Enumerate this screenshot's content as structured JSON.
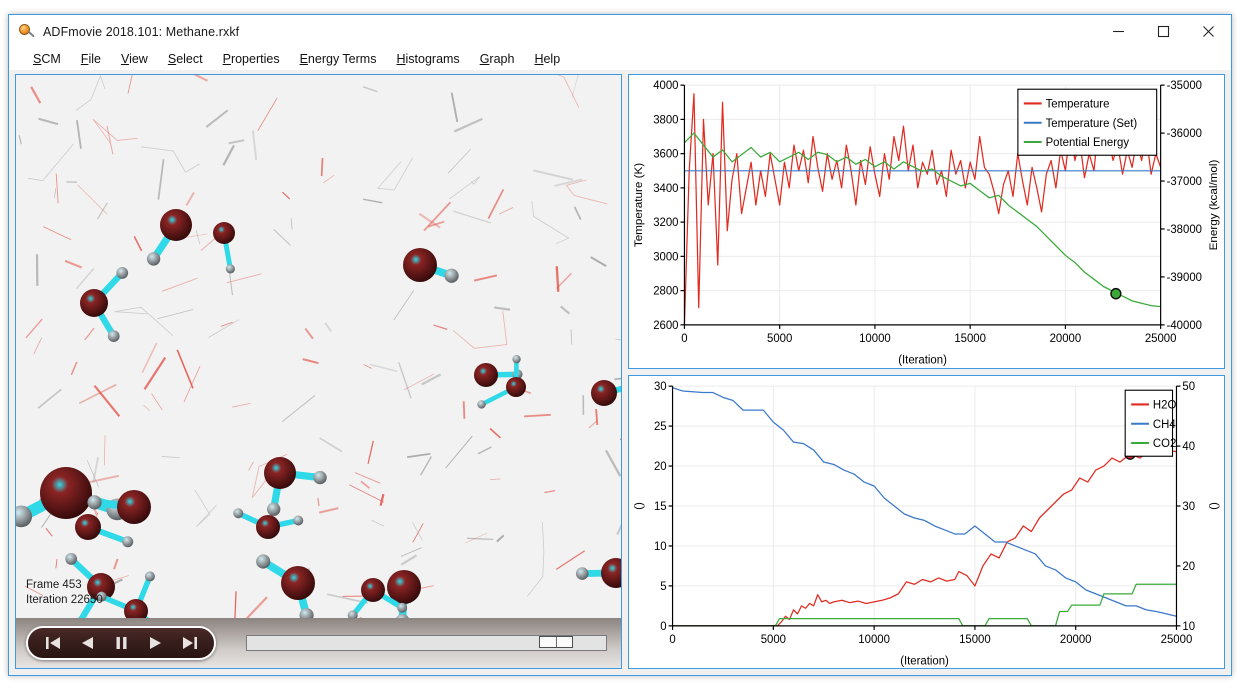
{
  "window": {
    "title": "ADFmovie 2018.101: Methane.rxkf",
    "icon": "magnifier-icon",
    "minimize_label": "–",
    "maximize_label": "□",
    "close_label": "✕"
  },
  "menubar": {
    "items": [
      {
        "label": "SCM",
        "mnemonic": "S"
      },
      {
        "label": "File",
        "mnemonic": "F"
      },
      {
        "label": "View",
        "mnemonic": "V"
      },
      {
        "label": "Select",
        "mnemonic": "S"
      },
      {
        "label": "Properties",
        "mnemonic": "P"
      },
      {
        "label": "Energy Terms",
        "mnemonic": "E"
      },
      {
        "label": "Histograms",
        "mnemonic": "H"
      },
      {
        "label": "Graph",
        "mnemonic": "G"
      },
      {
        "label": "Help",
        "mnemonic": "H"
      }
    ]
  },
  "viewport": {
    "frame_label": "Frame 453",
    "iteration_label": "Iteration 22650",
    "background_color": "#f2f2f2",
    "atom_colors": {
      "oxygen": "#5c1414",
      "hydrogen": "#8f9396",
      "bond": "#2fd9e8"
    }
  },
  "transport": {
    "buttons": [
      {
        "name": "skip-to-start-button",
        "icon": "skip-start-icon"
      },
      {
        "name": "step-back-button",
        "icon": "rewind-icon"
      },
      {
        "name": "pause-button",
        "icon": "pause-icon"
      },
      {
        "name": "play-button",
        "icon": "play-icon"
      },
      {
        "name": "skip-to-end-button",
        "icon": "skip-end-icon"
      }
    ]
  },
  "frame_slider": {
    "min": 0,
    "max": 100,
    "value": 90,
    "name": "frame-slider"
  },
  "chart_data": [
    {
      "type": "line",
      "id": "energy-chart",
      "title": "",
      "xlabel": "(Iteration)",
      "ylabel": "Temperature (K)",
      "ylabel_right": "Energy (kcal/mol)",
      "xlim": [
        0,
        25000
      ],
      "xticks": [
        0,
        5000,
        10000,
        15000,
        20000,
        25000
      ],
      "ylim": [
        2600,
        4000
      ],
      "yticks": [
        2600,
        2800,
        3000,
        3200,
        3400,
        3600,
        3800,
        4000
      ],
      "ylim_right": [
        -40000,
        -35000
      ],
      "yticks_right": [
        -40000,
        -39000,
        -38000,
        -37000,
        -36000,
        -35000
      ],
      "grid": true,
      "legend_position": "top-right",
      "marker": {
        "x": 22650,
        "y": -39350,
        "axis": "right",
        "color": "#3aa93a"
      },
      "series": [
        {
          "name": "Temperature",
          "color": "#e02b20",
          "axis": "left",
          "x": [
            0,
            250,
            500,
            750,
            1000,
            1250,
            1500,
            1750,
            2000,
            2250,
            2500,
            2750,
            3000,
            3250,
            3500,
            3750,
            4000,
            4250,
            4500,
            4750,
            5000,
            5250,
            5500,
            5750,
            6000,
            6250,
            6500,
            6750,
            7000,
            7250,
            7500,
            7750,
            8000,
            8250,
            8500,
            8750,
            9000,
            9250,
            9500,
            9750,
            10000,
            10250,
            10500,
            10750,
            11000,
            11250,
            11500,
            11750,
            12000,
            12250,
            12500,
            12750,
            13000,
            13250,
            13500,
            13750,
            14000,
            14250,
            14500,
            14750,
            15000,
            15250,
            15500,
            15750,
            16000,
            16250,
            16500,
            16750,
            17000,
            17250,
            17500,
            17750,
            18000,
            18250,
            18500,
            18750,
            19000,
            19250,
            19500,
            19750,
            20000,
            20250,
            20500,
            20750,
            21000,
            21250,
            21500,
            21750,
            22000,
            22250,
            22500,
            22750,
            23000,
            23250,
            23500,
            23750,
            24000,
            24250,
            24500,
            24750,
            25000
          ],
          "y": [
            2600,
            3500,
            3950,
            2700,
            3800,
            3300,
            3600,
            2950,
            3900,
            3150,
            3450,
            3600,
            3250,
            3400,
            3550,
            3300,
            3500,
            3350,
            3600,
            3450,
            3300,
            3550,
            3400,
            3650,
            3500,
            3620,
            3430,
            3700,
            3520,
            3380,
            3600,
            3450,
            3560,
            3400,
            3650,
            3500,
            3300,
            3560,
            3420,
            3640,
            3480,
            3350,
            3600,
            3450,
            3700,
            3560,
            3760,
            3500,
            3650,
            3400,
            3550,
            3480,
            3620,
            3420,
            3500,
            3350,
            3620,
            3480,
            3560,
            3400,
            3550,
            3450,
            3700,
            3520,
            3480,
            3380,
            3250,
            3420,
            3500,
            3350,
            3600,
            3440,
            3300,
            3520,
            3400,
            3260,
            3480,
            3560,
            3400,
            3620,
            3500,
            3740,
            3560,
            3680,
            3460,
            3600,
            3500,
            3780,
            3620,
            3700,
            3560,
            3650,
            3480,
            3620,
            3520,
            3680,
            3560,
            3700,
            3480,
            3600,
            3520
          ]
        },
        {
          "name": "Temperature (Set)",
          "color": "#3a78c9",
          "axis": "left",
          "x": [
            0,
            25000
          ],
          "y": [
            3500,
            3500
          ]
        },
        {
          "name": "Potential Energy",
          "color": "#3aa93a",
          "axis": "right",
          "x": [
            0,
            500,
            1000,
            1500,
            2000,
            2500,
            3000,
            3500,
            4000,
            4500,
            5000,
            5500,
            6000,
            6500,
            7000,
            7500,
            8000,
            8500,
            9000,
            9500,
            10000,
            10500,
            11000,
            11500,
            12000,
            12500,
            13000,
            13500,
            14000,
            14500,
            15000,
            15500,
            16000,
            16500,
            17000,
            17500,
            18000,
            18500,
            19000,
            19500,
            20000,
            20500,
            21000,
            21500,
            22000,
            22500,
            22650,
            23000,
            23500,
            24000,
            24500,
            25000
          ],
          "y": [
            -36200,
            -36000,
            -36250,
            -36500,
            -36350,
            -36600,
            -36450,
            -36300,
            -36500,
            -36400,
            -36600,
            -36500,
            -36400,
            -36550,
            -36400,
            -36450,
            -36600,
            -36500,
            -36650,
            -36550,
            -36700,
            -36600,
            -36750,
            -36600,
            -36700,
            -36800,
            -36750,
            -36900,
            -37000,
            -37100,
            -37050,
            -37200,
            -37350,
            -37300,
            -37500,
            -37650,
            -37800,
            -37950,
            -38150,
            -38350,
            -38550,
            -38700,
            -38900,
            -39050,
            -39200,
            -39300,
            -39350,
            -39400,
            -39500,
            -39550,
            -39600,
            -39620
          ]
        }
      ]
    },
    {
      "type": "line",
      "id": "species-chart",
      "title": "",
      "xlabel": "(Iteration)",
      "ylabel": "()",
      "ylabel_right": "()",
      "xlim": [
        0,
        25000
      ],
      "xticks": [
        0,
        5000,
        10000,
        15000,
        20000,
        25000
      ],
      "ylim": [
        0,
        30
      ],
      "yticks": [
        0,
        5,
        10,
        15,
        20,
        25,
        30
      ],
      "ylim_right": [
        10,
        50
      ],
      "yticks_right": [
        10,
        20,
        30,
        40,
        50
      ],
      "grid": true,
      "legend_position": "top-right",
      "marker": {
        "x": 22700,
        "y": 21.5,
        "axis": "left",
        "color": "#e02b20"
      },
      "series": [
        {
          "name": "H2O",
          "color": "#e02b20",
          "axis": "left",
          "x": [
            0,
            5200,
            5400,
            5600,
            5800,
            6000,
            6200,
            6400,
            6600,
            6800,
            7000,
            7200,
            7400,
            7600,
            7800,
            8000,
            8400,
            8800,
            9200,
            9600,
            10000,
            10400,
            10800,
            11200,
            11600,
            12000,
            12400,
            12800,
            13200,
            13600,
            14000,
            14200,
            14600,
            15000,
            15400,
            15800,
            16200,
            16600,
            17000,
            17400,
            17800,
            18200,
            18600,
            19000,
            19400,
            19800,
            20200,
            20600,
            21000,
            21400,
            21800,
            22200,
            22700,
            23200,
            23600,
            24000,
            24400,
            25000
          ],
          "y": [
            0,
            0,
            0.5,
            1.2,
            0.8,
            2.0,
            1.5,
            2.5,
            2.2,
            2.8,
            2.5,
            3.9,
            3.0,
            3.2,
            2.8,
            3.0,
            3.2,
            2.9,
            3.1,
            2.8,
            3.0,
            3.2,
            3.5,
            4.0,
            5.5,
            5.2,
            5.8,
            5.5,
            6.0,
            5.6,
            5.8,
            6.8,
            6.3,
            5.0,
            7.5,
            9.0,
            8.5,
            10.5,
            11.0,
            12.5,
            11.8,
            13.5,
            14.5,
            15.5,
            16.5,
            17.0,
            18.5,
            18.0,
            19.5,
            20.0,
            21.0,
            20.5,
            21.5,
            21.0,
            22.0,
            21.5,
            22.0,
            21.8
          ]
        },
        {
          "name": "CH4",
          "color": "#3a78c9",
          "axis": "left",
          "x": [
            0,
            500,
            1000,
            1500,
            2000,
            2500,
            3000,
            3500,
            4000,
            4500,
            5000,
            5500,
            6000,
            6500,
            7000,
            7500,
            8000,
            8500,
            9000,
            9500,
            10000,
            10500,
            11000,
            11500,
            12000,
            12500,
            13000,
            13500,
            14000,
            14500,
            15000,
            15500,
            16000,
            16500,
            17000,
            17500,
            18000,
            18500,
            19000,
            19500,
            20000,
            20500,
            21000,
            21500,
            22000,
            22500,
            23000,
            23500,
            24000,
            24500,
            25000
          ],
          "y": [
            29.8,
            29.4,
            29.3,
            29.2,
            29.2,
            28.6,
            28.2,
            27.0,
            27.0,
            27.0,
            25.5,
            24.5,
            23.0,
            22.8,
            22.0,
            20.5,
            20.2,
            19.5,
            19.0,
            18.0,
            17.5,
            16.0,
            15.0,
            14.0,
            13.5,
            13.2,
            12.5,
            12.0,
            11.5,
            11.5,
            12.5,
            11.5,
            10.5,
            10.5,
            10.0,
            9.5,
            9.0,
            7.5,
            7.0,
            6.0,
            5.5,
            4.5,
            4.0,
            3.5,
            3.0,
            2.5,
            2.5,
            2.0,
            1.8,
            1.5,
            1.2
          ]
        },
        {
          "name": "CO2",
          "color": "#3aa93a",
          "axis": "left",
          "x": [
            0,
            5100,
            5300,
            5500,
            14200,
            14400,
            15500,
            15700,
            17600,
            17800,
            19000,
            19200,
            19600,
            19800,
            21200,
            21400,
            22800,
            23000,
            25000
          ],
          "y": [
            0,
            0,
            0.9,
            0.9,
            0.9,
            0.0,
            0.0,
            0.9,
            0.9,
            0.0,
            0.0,
            1.8,
            1.8,
            2.6,
            2.6,
            4.0,
            4.0,
            5.2,
            5.2
          ]
        }
      ]
    }
  ]
}
